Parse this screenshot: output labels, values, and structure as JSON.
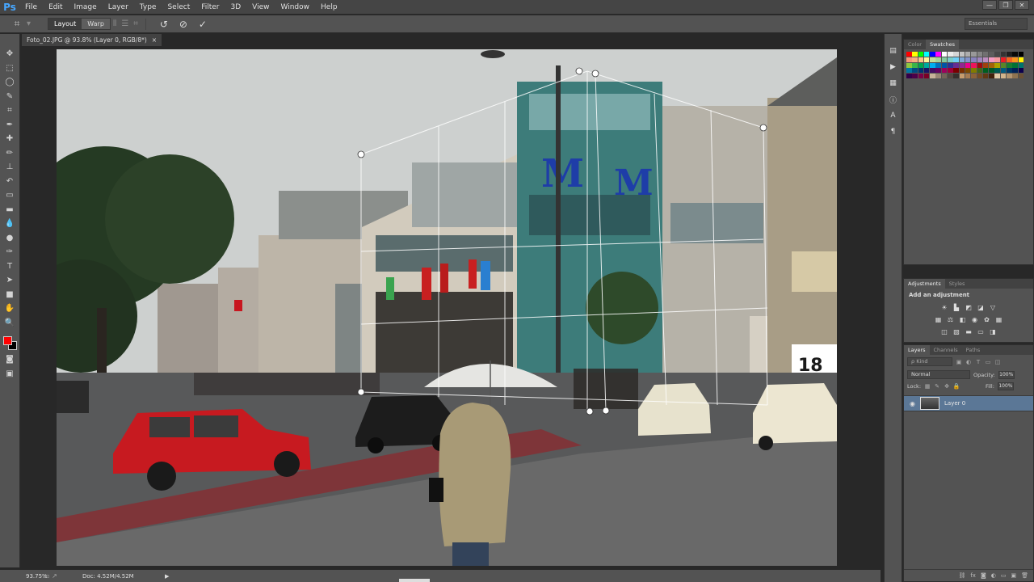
{
  "app": {
    "logo": "Ps"
  },
  "menu": [
    "File",
    "Edit",
    "Image",
    "Layer",
    "Type",
    "Select",
    "Filter",
    "3D",
    "View",
    "Window",
    "Help"
  ],
  "window_controls": {
    "minimize": "—",
    "restore": "❐",
    "close": "✕"
  },
  "options_bar": {
    "tool_icon": "crop-tool",
    "modes": [
      "Layout",
      "Warp"
    ],
    "workspace": "Essentials"
  },
  "document": {
    "tab_label": "Foto_02.JPG @ 93.8% (Layer 0, RGB/8*)",
    "tab_close": "×"
  },
  "tools": [
    "move",
    "marquee",
    "lasso",
    "quick-select",
    "crop",
    "eyedropper",
    "healing-brush",
    "brush",
    "clone-stamp",
    "history-brush",
    "eraser",
    "gradient",
    "blur",
    "dodge",
    "pen",
    "type",
    "path-select",
    "shape",
    "hand",
    "zoom"
  ],
  "colors": {
    "foreground": "#ff0000",
    "background": "#000000"
  },
  "status": {
    "zoom": "93.75%",
    "doc": "Doc: 4.52M/4.52M",
    "arrow": "▶"
  },
  "swatch_panel": {
    "tabs": [
      "Color",
      "Swatches"
    ],
    "active_tab": "Swatches",
    "colors": [
      "#ff0000",
      "#ffff00",
      "#00ff00",
      "#00ffff",
      "#0000ff",
      "#ff00ff",
      "#ffffff",
      "#ebebeb",
      "#d6d6d6",
      "#c2c2c2",
      "#adadad",
      "#999999",
      "#858585",
      "#707070",
      "#5c5c5c",
      "#474747",
      "#333333",
      "#1f1f1f",
      "#0a0a0a",
      "#000000",
      "#f7977a",
      "#f9ad81",
      "#fdc68a",
      "#fff79a",
      "#c4df9b",
      "#a2d39c",
      "#82ca9d",
      "#7bcdc8",
      "#6ecff6",
      "#7ea7d8",
      "#8493ca",
      "#8882be",
      "#a187be",
      "#bc8dbf",
      "#f49ac2",
      "#f6989d",
      "#ed1c24",
      "#f26522",
      "#f7941d",
      "#fff200",
      "#8dc63f",
      "#39b54a",
      "#00a651",
      "#00a99d",
      "#00aeef",
      "#0072bc",
      "#0054a6",
      "#2e3192",
      "#662d91",
      "#92278f",
      "#ec008c",
      "#ed145b",
      "#9e0b0f",
      "#a0410d",
      "#a3620a",
      "#aba000",
      "#598527",
      "#197b30",
      "#007236",
      "#00746b",
      "#0076a3",
      "#004a80",
      "#003471",
      "#1b1464",
      "#440e62",
      "#630460",
      "#9e005d",
      "#9e0039",
      "#790000",
      "#7b2e00",
      "#7d4900",
      "#827b00",
      "#406618",
      "#005e20",
      "#005826",
      "#005952",
      "#005b7f",
      "#003663",
      "#002157",
      "#0d004c",
      "#32004b",
      "#4b0049",
      "#7b0046",
      "#7a0026",
      "#c7b299",
      "#998675",
      "#736357",
      "#534741",
      "#37302d",
      "#c69c6d",
      "#a67c52",
      "#8c6239",
      "#754c24",
      "#603913",
      "#42210b",
      "#e0c9a6",
      "#d2b48c",
      "#b29470",
      "#8f7350",
      "#6b5236"
    ]
  },
  "adjustments_panel": {
    "tabs": [
      "Adjustments",
      "Styles"
    ],
    "active_tab": "Adjustments",
    "title": "Add an adjustment"
  },
  "layers_panel": {
    "tabs": [
      "Layers",
      "Channels",
      "Paths"
    ],
    "active_tab": "Layers",
    "kind": "ρ Kind",
    "blend_mode": "Normal",
    "opacity_label": "Opacity:",
    "opacity_value": "100%",
    "lock_label": "Lock:",
    "fill_label": "Fill:",
    "fill_value": "100%",
    "layers": [
      {
        "name": "Layer 0",
        "visible": true
      }
    ]
  }
}
